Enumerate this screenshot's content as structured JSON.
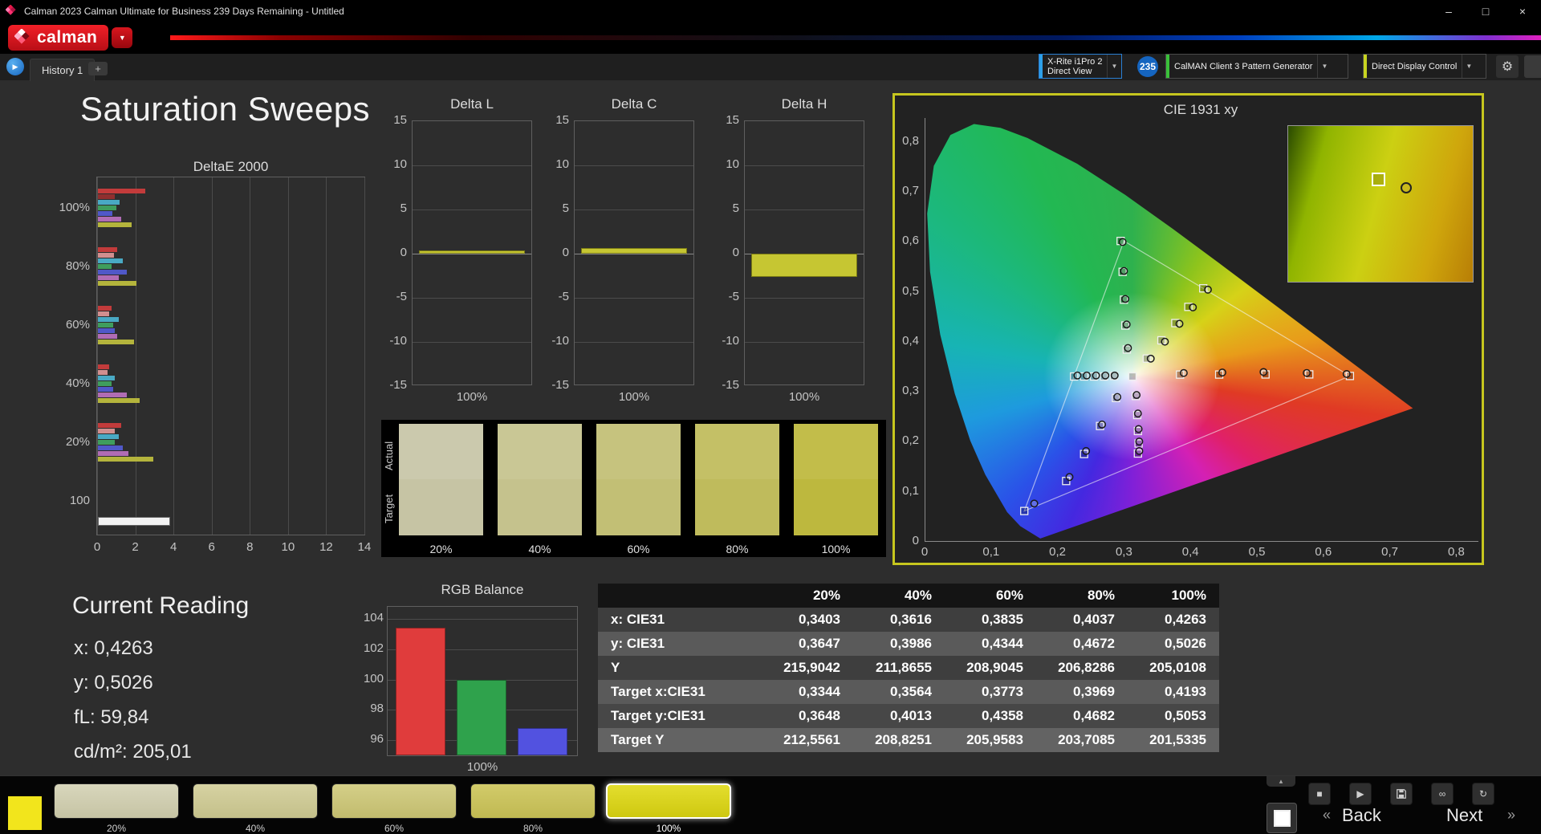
{
  "window": {
    "title": "Calman 2023 Calman Ultimate for Business 239 Days Remaining  - Untitled",
    "minimize": "–",
    "maximize": "□",
    "close": "×"
  },
  "brand": {
    "name": "calman"
  },
  "tabbar": {
    "active_tab": "History 1",
    "add": "+",
    "nav": "▶"
  },
  "devices": {
    "meter": {
      "line1": "X-Rite i1Pro 2",
      "line2": "Direct View",
      "badge": "235",
      "accent": "#2d9fe8"
    },
    "pattern": {
      "label": "CalMAN Client 3 Pattern Generator",
      "accent": "#39c039"
    },
    "display": {
      "label": "Direct Display Control",
      "accent": "#c8d420"
    }
  },
  "page": {
    "title": "Saturation Sweeps"
  },
  "deltae": {
    "title": "DeltaE 2000",
    "row_labels": [
      "100%",
      "80%",
      "60%",
      "40%",
      "20%",
      "100"
    ],
    "xticks": [
      "0",
      "2",
      "4",
      "6",
      "8",
      "10",
      "12",
      "14"
    ],
    "xmax": 14,
    "groups": [
      [
        {
          "c": "#c23b3b",
          "v": 2.5
        },
        {
          "c": "#8f2f2f",
          "v": 0.9
        },
        {
          "c": "#49a9c4",
          "v": 1.15
        },
        {
          "c": "#3f9d5d",
          "v": 0.95
        },
        {
          "c": "#5058c8",
          "v": 0.75
        },
        {
          "c": "#b06cb4",
          "v": 1.2
        },
        {
          "c": "#b4b43c",
          "v": 1.75
        }
      ],
      [
        {
          "c": "#c23b3b",
          "v": 1.0
        },
        {
          "c": "#d18f8f",
          "v": 0.85
        },
        {
          "c": "#49a9c4",
          "v": 1.3
        },
        {
          "c": "#3f9d5d",
          "v": 0.7
        },
        {
          "c": "#5058c8",
          "v": 1.5
        },
        {
          "c": "#b06cb4",
          "v": 1.1
        },
        {
          "c": "#b4b43c",
          "v": 2.0
        }
      ],
      [
        {
          "c": "#c23b3b",
          "v": 0.7
        },
        {
          "c": "#d18f8f",
          "v": 0.6
        },
        {
          "c": "#49a9c4",
          "v": 1.1
        },
        {
          "c": "#3f9d5d",
          "v": 0.8
        },
        {
          "c": "#5058c8",
          "v": 0.9
        },
        {
          "c": "#b06cb4",
          "v": 1.0
        },
        {
          "c": "#b4b43c",
          "v": 1.9
        }
      ],
      [
        {
          "c": "#c23b3b",
          "v": 0.6
        },
        {
          "c": "#d18f8f",
          "v": 0.5
        },
        {
          "c": "#49a9c4",
          "v": 0.9
        },
        {
          "c": "#3f9d5d",
          "v": 0.7
        },
        {
          "c": "#5058c8",
          "v": 0.8
        },
        {
          "c": "#b06cb4",
          "v": 1.5
        },
        {
          "c": "#b4b43c",
          "v": 2.2
        }
      ],
      [
        {
          "c": "#c23b3b",
          "v": 1.2
        },
        {
          "c": "#d18f8f",
          "v": 0.9
        },
        {
          "c": "#49a9c4",
          "v": 1.1
        },
        {
          "c": "#3f9d5d",
          "v": 0.9
        },
        {
          "c": "#5058c8",
          "v": 1.3
        },
        {
          "c": "#b06cb4",
          "v": 1.6
        },
        {
          "c": "#b4b43c",
          "v": 2.9
        }
      ],
      [
        {
          "c": "#f2f2f2",
          "v": 3.7
        }
      ]
    ]
  },
  "delta_charts": {
    "yticks": [
      "15",
      "10",
      "5",
      "0",
      "-5",
      "-10",
      "-15"
    ],
    "xlabel": "100%",
    "bar_color": "#c6c632",
    "bar_border": "#7a7a14",
    "items": [
      {
        "title": "Delta L",
        "value": 0.4
      },
      {
        "title": "Delta C",
        "value": 0.6
      },
      {
        "title": "Delta H",
        "value": -2.6
      }
    ]
  },
  "swatch_panel": {
    "row_labels": [
      "Actual",
      "Target"
    ],
    "levels": [
      "20%",
      "40%",
      "60%",
      "80%",
      "100%"
    ],
    "actual": [
      "#cbc9ad",
      "#c9c795",
      "#c6c37e",
      "#c4c066",
      "#c2bd4a"
    ],
    "target": [
      "#c6c4a4",
      "#c5c28d",
      "#c2bf75",
      "#bfbb5c",
      "#bdb83e"
    ]
  },
  "reading": {
    "title": "Current Reading",
    "lines": [
      "x: 0,4263",
      "y: 0,5026",
      "fL: 59,84",
      "cd/m²: 205,01"
    ]
  },
  "rgb": {
    "title": "RGB Balance",
    "yticks": [
      104,
      102,
      100,
      98,
      96
    ],
    "ymin": 95,
    "ymax": 104.8,
    "xlabel": "100%",
    "bars": [
      {
        "name": "red",
        "color": "#e03c3c",
        "value": 103.4
      },
      {
        "name": "green",
        "color": "#2fa24c",
        "value": 100.0
      },
      {
        "name": "blue",
        "color": "#5252e0",
        "value": 96.8
      }
    ]
  },
  "table": {
    "headers": [
      "",
      "20%",
      "40%",
      "60%",
      "80%",
      "100%"
    ],
    "row_colors": [
      "#3e3e3e",
      "#5a5a5a",
      "#3e3e3e",
      "#5a5a5a",
      "#474747",
      "#636363"
    ],
    "rows": [
      {
        "label": "x: CIE31",
        "values": [
          "0,3403",
          "0,3616",
          "0,3835",
          "0,4037",
          "0,4263"
        ]
      },
      {
        "label": "y: CIE31",
        "values": [
          "0,3647",
          "0,3986",
          "0,4344",
          "0,4672",
          "0,5026"
        ]
      },
      {
        "label": "Y",
        "values": [
          "215,9042",
          "211,8655",
          "208,9045",
          "206,8286",
          "205,0108"
        ]
      },
      {
        "label": "Target x:CIE31",
        "values": [
          "0,3344",
          "0,3564",
          "0,3773",
          "0,3969",
          "0,4193"
        ]
      },
      {
        "label": "Target y:CIE31",
        "values": [
          "0,3648",
          "0,4013",
          "0,4358",
          "0,4682",
          "0,5053"
        ]
      },
      {
        "label": "Target Y",
        "values": [
          "212,5561",
          "208,8251",
          "205,9583",
          "203,7085",
          "201,5335"
        ]
      }
    ]
  },
  "cie": {
    "title": "CIE 1931 xy",
    "xticks": [
      "0",
      "0,1",
      "0,2",
      "0,3",
      "0,4",
      "0,5",
      "0,6",
      "0,7",
      "0,8"
    ],
    "yticks": [
      "0,8",
      "0,7",
      "0,6",
      "0,5",
      "0,4",
      "0,3",
      "0,2",
      "0,1",
      "0"
    ],
    "triangle": [
      [
        0.64,
        0.33
      ],
      [
        0.3,
        0.6
      ],
      [
        0.15,
        0.06
      ]
    ],
    "white_point": [
      0.3127,
      0.329
    ],
    "targets": [
      [
        0.3844,
        0.3328
      ],
      [
        0.4433,
        0.3329
      ],
      [
        0.513,
        0.3331
      ],
      [
        0.5788,
        0.3332
      ],
      [
        0.64,
        0.33
      ],
      [
        0.3043,
        0.3829
      ],
      [
        0.3021,
        0.431
      ],
      [
        0.3,
        0.4826
      ],
      [
        0.298,
        0.5383
      ],
      [
        0.295,
        0.6
      ],
      [
        0.288,
        0.286
      ],
      [
        0.264,
        0.23
      ],
      [
        0.24,
        0.174
      ],
      [
        0.213,
        0.12
      ],
      [
        0.15,
        0.06
      ],
      [
        0.285,
        0.33
      ],
      [
        0.27,
        0.329
      ],
      [
        0.255,
        0.329
      ],
      [
        0.24,
        0.329
      ],
      [
        0.225,
        0.329
      ],
      [
        0.318,
        0.29
      ],
      [
        0.32,
        0.252
      ],
      [
        0.321,
        0.22
      ],
      [
        0.322,
        0.195
      ],
      [
        0.321,
        0.175
      ],
      [
        0.3344,
        0.3648
      ],
      [
        0.3564,
        0.4013
      ],
      [
        0.3773,
        0.4358
      ],
      [
        0.3969,
        0.4682
      ],
      [
        0.4193,
        0.5053
      ]
    ],
    "measured": [
      [
        0.39,
        0.336
      ],
      [
        0.448,
        0.337
      ],
      [
        0.51,
        0.338
      ],
      [
        0.575,
        0.336
      ],
      [
        0.635,
        0.334
      ],
      [
        0.306,
        0.386
      ],
      [
        0.304,
        0.433
      ],
      [
        0.302,
        0.484
      ],
      [
        0.3,
        0.54
      ],
      [
        0.298,
        0.598
      ],
      [
        0.29,
        0.288
      ],
      [
        0.267,
        0.233
      ],
      [
        0.243,
        0.18
      ],
      [
        0.218,
        0.128
      ],
      [
        0.165,
        0.075
      ],
      [
        0.286,
        0.331
      ],
      [
        0.272,
        0.331
      ],
      [
        0.258,
        0.331
      ],
      [
        0.244,
        0.331
      ],
      [
        0.23,
        0.331
      ],
      [
        0.319,
        0.292
      ],
      [
        0.321,
        0.255
      ],
      [
        0.322,
        0.224
      ],
      [
        0.323,
        0.199
      ],
      [
        0.323,
        0.18
      ],
      [
        0.3403,
        0.3647
      ],
      [
        0.3616,
        0.3986
      ],
      [
        0.3835,
        0.4344
      ],
      [
        0.4037,
        0.4672
      ],
      [
        0.4263,
        0.5026
      ]
    ]
  },
  "media": {
    "stop": "■",
    "play": "▶",
    "link": "∞",
    "refresh": "↻",
    "collapse": "▴"
  },
  "bottombar": {
    "patch_color": "#f2e51c",
    "swatches": [
      {
        "label": "20%",
        "top": "#d8d6bc",
        "bottom": "#c6c4a4",
        "selected": false
      },
      {
        "label": "40%",
        "top": "#d6d2a2",
        "bottom": "#c4c08a",
        "selected": false
      },
      {
        "label": "60%",
        "top": "#d4cf88",
        "bottom": "#c2bc6e",
        "selected": false
      },
      {
        "label": "80%",
        "top": "#d2cb6a",
        "bottom": "#c0b952",
        "selected": false
      },
      {
        "label": "100%",
        "top": "#e4de2e",
        "bottom": "#cec810",
        "selected": true
      }
    ],
    "back": "Back",
    "next": "Next",
    "chevron_left": "«",
    "chevron_right": "»"
  }
}
